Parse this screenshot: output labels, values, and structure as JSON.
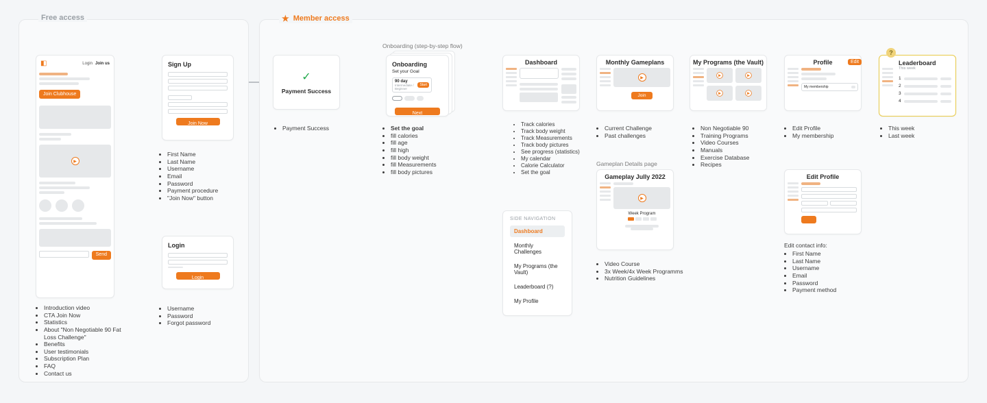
{
  "sections": {
    "free": "Free access",
    "member": "Member access"
  },
  "landing": {
    "login": "Login",
    "join": "Join us",
    "cta": "Join Clubhouse",
    "send": "Send"
  },
  "landing_list": [
    "Introduction video",
    "CTA Join Now",
    "Statistics",
    "About \"Non Negotiable 90 Fat Loss Challenge\"",
    "Benefits",
    "User testimonials",
    "Subscription Plan",
    "FAQ",
    "Contact us"
  ],
  "signup": {
    "title": "Sign Up",
    "btn": "Join Now",
    "list": [
      "First Name",
      "Last Name",
      "Username",
      "Email",
      "Password",
      "Payment procedure",
      "\"Join Now\" button"
    ]
  },
  "login": {
    "title": "Login",
    "btn": "Login",
    "list": [
      "Username",
      "Password",
      "Forgot password"
    ]
  },
  "payment": {
    "title": "Payment Success",
    "list": [
      "Payment Success"
    ]
  },
  "onboarding_annot": "Onboarding (step-by-step flow)",
  "onboarding": {
    "title": "Onboarding",
    "subtitle": "Set your Goal",
    "pill_title": "90 day",
    "pill_sub": "Intermediate / Beginner",
    "pill_btn": "Start",
    "next": "Next",
    "list_bold": "Set the goal",
    "list": [
      "fill calories",
      "fill age",
      "fill high",
      "fill body weight",
      "fill Measurements",
      "fill body pictures"
    ]
  },
  "dashboard": {
    "title": "Dashboard",
    "list": [
      "Track calories",
      "Track body weight",
      "Track Measurements",
      "Track body pictures",
      "See progress (statistics)",
      "My calendar",
      "Calorie Calculator",
      "Set the goal"
    ]
  },
  "sidenav": {
    "header": "SIDE NAVIGATION",
    "items": [
      "Dashboard",
      "Monthly Challenges",
      "My Programs (the Vault)",
      "Leaderboard (?)",
      "My Profile"
    ]
  },
  "gameplans": {
    "title": "Monthly Gameplans",
    "btn": "Join",
    "list": [
      "Current Challenge",
      "Past challenges"
    ],
    "annot": "Gameplan Details page",
    "detail_title": "Gameplay Jully 2022",
    "detail_sub": "Week Program",
    "detail_list": [
      "Video Course",
      "3x Week/4x Week Programms",
      "Nutrition Guidelines"
    ]
  },
  "programs": {
    "title": "My Programs (the Vault)",
    "list": [
      "Non Negotiable 90",
      "Training Programs",
      "Video Courses",
      "Manuals",
      "Exercise Database",
      "Recipes"
    ]
  },
  "profile": {
    "title": "Profile",
    "edit_badge": "Edit",
    "membership": "My membership",
    "list": [
      "Edit Profile",
      "My membership"
    ]
  },
  "edit_profile": {
    "title": "Edit Profile",
    "annot": "Edit contact info:",
    "list": [
      "First Name",
      "Last Name",
      "Username",
      "Email",
      "Password",
      "Payment method"
    ]
  },
  "leaderboard": {
    "title": "Leaderboard",
    "sub": "This week",
    "q": "?",
    "ranks": [
      "1",
      "2",
      "3",
      "4"
    ],
    "list": [
      "This week",
      "Last week"
    ]
  }
}
